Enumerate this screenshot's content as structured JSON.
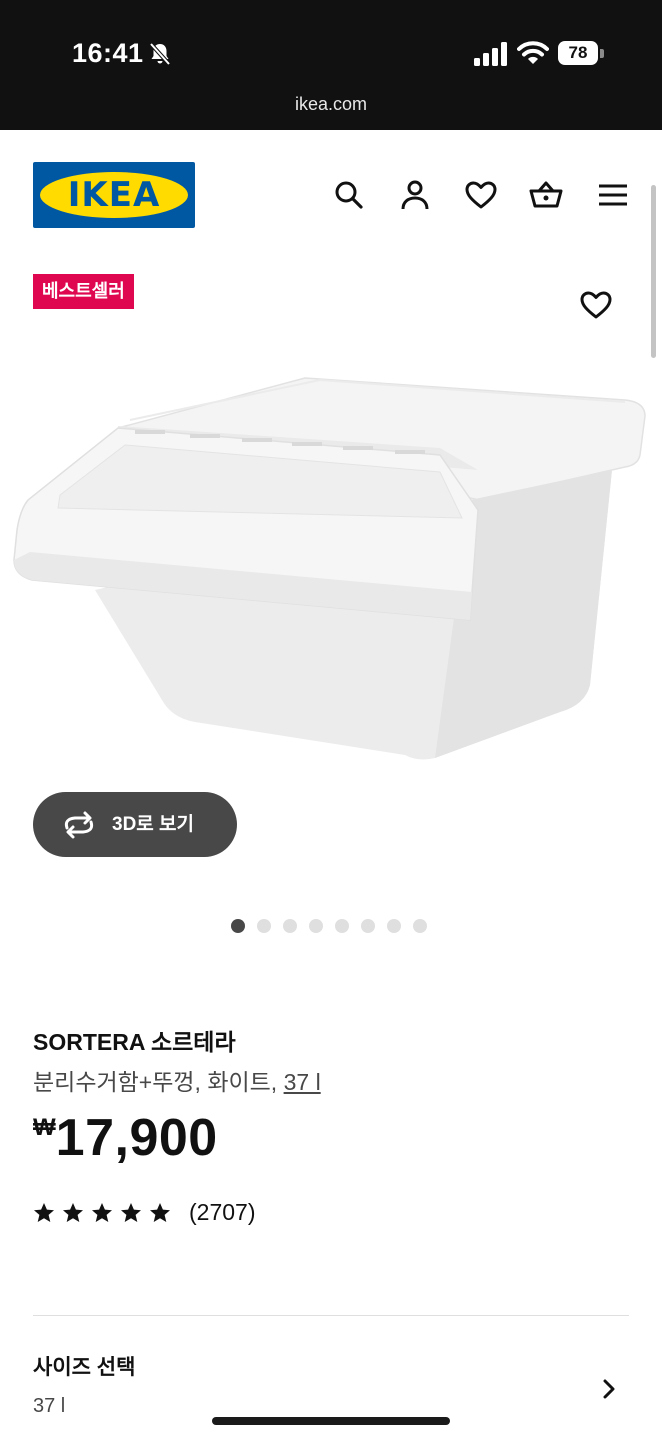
{
  "status_bar": {
    "time": "16:41",
    "battery": "78",
    "url": "ikea.com",
    "icons": [
      "bell-slash-icon",
      "cellular-signal-icon",
      "wifi-icon",
      "battery-icon"
    ]
  },
  "header": {
    "logo_text": "IKEA",
    "icons": [
      "search-icon",
      "user-icon",
      "heart-icon",
      "basket-icon",
      "menu-icon"
    ]
  },
  "product_media": {
    "badge": "베스트셀러",
    "view_3d_label": "3D로 보기",
    "carousel": {
      "total": 8,
      "active_index": 0
    }
  },
  "product": {
    "name": "SORTERA 소르테라",
    "description": "분리수거함+뚜껑, 화이트, ",
    "size_link": "37 l",
    "price_currency": "₩",
    "price_amount": "17,900",
    "rating_stars": 5,
    "review_count": "(2707)"
  },
  "size_selector": {
    "title": "사이즈 선택",
    "value": "37 l"
  },
  "colors": {
    "brand_blue": "#0058a3",
    "brand_yellow": "#ffdb00",
    "badge_red": "#e00751",
    "status_bar": "#111111"
  }
}
